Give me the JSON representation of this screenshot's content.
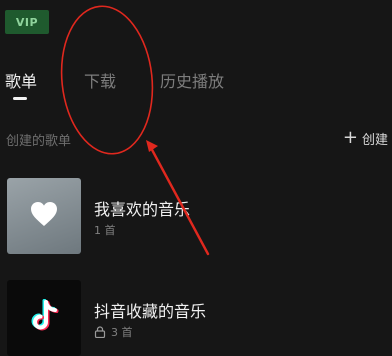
{
  "header": {
    "vip_label": "VIP"
  },
  "tabs": [
    {
      "label": "歌单",
      "active": true
    },
    {
      "label": "下载",
      "active": false
    },
    {
      "label": "历史播放",
      "active": false
    }
  ],
  "section": {
    "title": "创建的歌单",
    "create_label": "创建"
  },
  "playlists": [
    {
      "title": "我喜欢的音乐",
      "count": "1 首",
      "icon": "heart-icon",
      "private": false
    },
    {
      "title": "抖音收藏的音乐",
      "count": "3 首",
      "icon": "tiktok-icon",
      "private": true
    }
  ],
  "colors": {
    "background": "#161616",
    "vip_bg": "#1f5a2e",
    "vip_text": "#8fd39c",
    "annotation_red": "#e0281e"
  }
}
